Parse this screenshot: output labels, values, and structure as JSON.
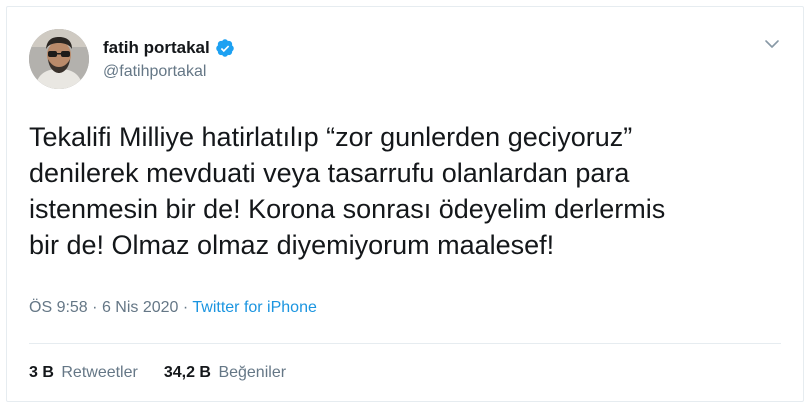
{
  "tweet": {
    "author": {
      "display_name": "fatih portakal",
      "handle": "@fatihportakal",
      "verified": true
    },
    "text_lines": [
      "Tekalifi Milliye hatirlatılıp “zor gunlerden geciyoruz”",
      "denilerek mevduati veya tasarrufu olanlardan para",
      "istenmesin bir de! Korona sonrası ödeyelim derlermis",
      "bir de! Olmaz olmaz diyemiyorum maalesef!"
    ],
    "time": "ÖS 9:58",
    "date": "6 Nis 2020",
    "separator": "·",
    "source": "Twitter for iPhone",
    "stats": {
      "retweets_count": "3 B",
      "retweets_label": "Retweetler",
      "likes_count": "34,2 B",
      "likes_label": "Beğeniler"
    }
  },
  "icons": {
    "verified": "verified-badge-icon",
    "menu": "chevron-down-icon"
  },
  "colors": {
    "link": "#1b95e0",
    "secondary_text": "#657786",
    "primary_text": "#14171a",
    "verified_badge": "#1da1f2",
    "border": "#e6ecf0"
  }
}
